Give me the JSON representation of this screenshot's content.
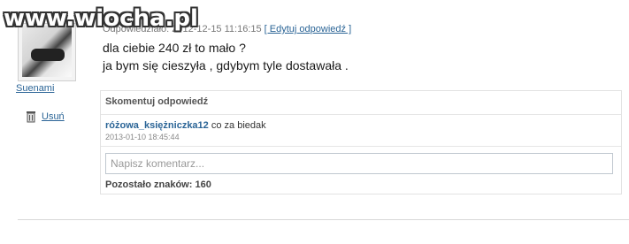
{
  "watermark": "www.wiocha.pl",
  "user": {
    "name": "Suenami",
    "delete_label": "Usuń"
  },
  "answer": {
    "meta_prefix": "Odpowiedziało: ",
    "timestamp": "2012-12-15 11:16:15",
    "edit_label": "[ Edytuj odpowiedź ]",
    "line1": "dla ciebie 240 zł to mało ?",
    "line2": "ja bym się cieszyła , gdybym tyle dostawała ."
  },
  "comments": {
    "header": "Skomentuj odpowiedź",
    "items": [
      {
        "user": "różowa_księżniczka12",
        "text": " co za biedak",
        "date": "2013-01-10 18:45:44"
      }
    ],
    "input_placeholder": "Napisz komentarz...",
    "chars_left": "Pozostało znaków: 160"
  },
  "icons": {
    "trash": "trash-icon"
  }
}
